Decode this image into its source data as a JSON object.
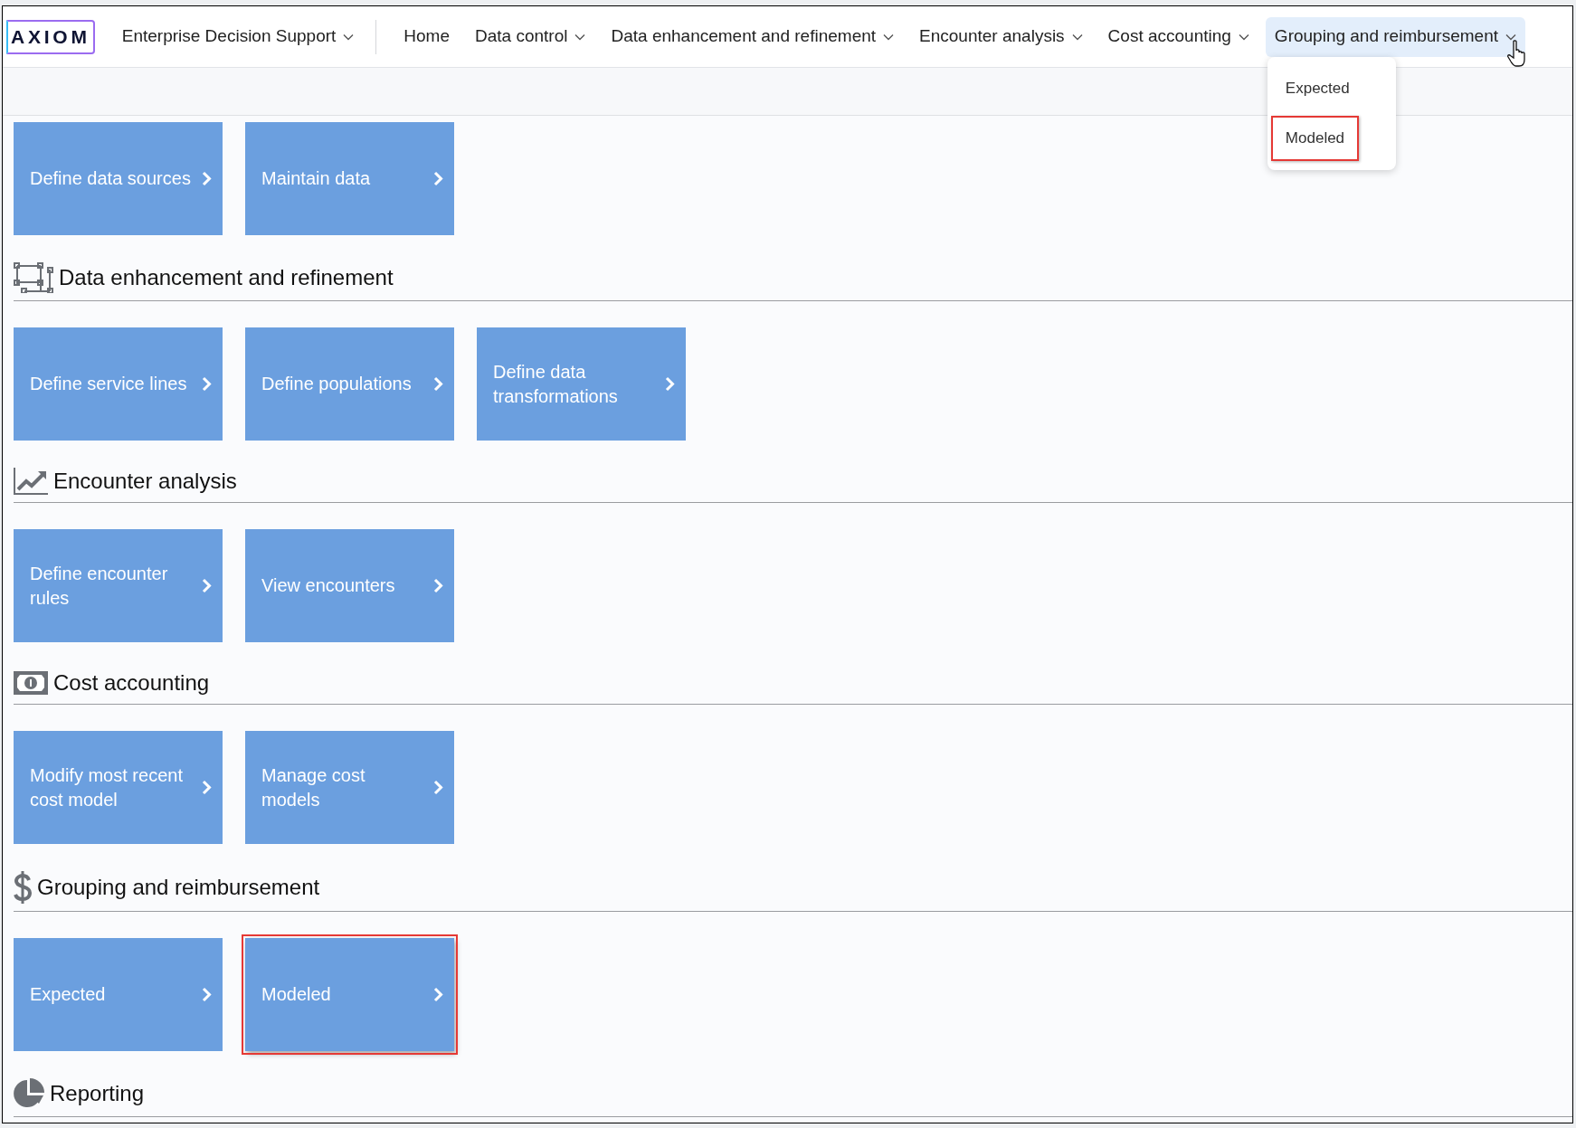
{
  "logo": {
    "text": "AXIOM"
  },
  "product_menu": {
    "label": "Enterprise Decision Support"
  },
  "nav": [
    {
      "label": "Home",
      "has_menu": false,
      "expanded": false
    },
    {
      "label": "Data control",
      "has_menu": true,
      "expanded": false
    },
    {
      "label": "Data enhancement and refinement",
      "has_menu": true,
      "expanded": false
    },
    {
      "label": "Encounter analysis",
      "has_menu": true,
      "expanded": false
    },
    {
      "label": "Cost accounting",
      "has_menu": true,
      "expanded": false
    },
    {
      "label": "Grouping and reimbursement",
      "has_menu": true,
      "expanded": true
    }
  ],
  "dropdown": {
    "items": [
      {
        "label": "Expected",
        "highlighted": false
      },
      {
        "label": "Modeled",
        "highlighted": true
      }
    ]
  },
  "sections": [
    {
      "tiles": [
        {
          "label": "Define data sources",
          "highlighted": false
        },
        {
          "label": "Maintain data",
          "highlighted": false
        }
      ]
    },
    {
      "title": "Data enhancement and refinement",
      "tiles": [
        {
          "label": "Define service lines",
          "highlighted": false
        },
        {
          "label": "Define populations",
          "highlighted": false
        },
        {
          "label": "Define data transformations",
          "highlighted": false
        }
      ]
    },
    {
      "title": "Encounter analysis",
      "tiles": [
        {
          "label": "Define encounter rules",
          "highlighted": false
        },
        {
          "label": "View encounters",
          "highlighted": false
        }
      ]
    },
    {
      "title": "Cost accounting",
      "tiles": [
        {
          "label": "Modify most recent cost model",
          "highlighted": false
        },
        {
          "label": "Manage cost models",
          "highlighted": false
        }
      ]
    },
    {
      "title": "Grouping and reimbursement",
      "tiles": [
        {
          "label": "Expected",
          "highlighted": false
        },
        {
          "label": "Modeled",
          "highlighted": true
        }
      ]
    },
    {
      "title": "Reporting"
    }
  ]
}
